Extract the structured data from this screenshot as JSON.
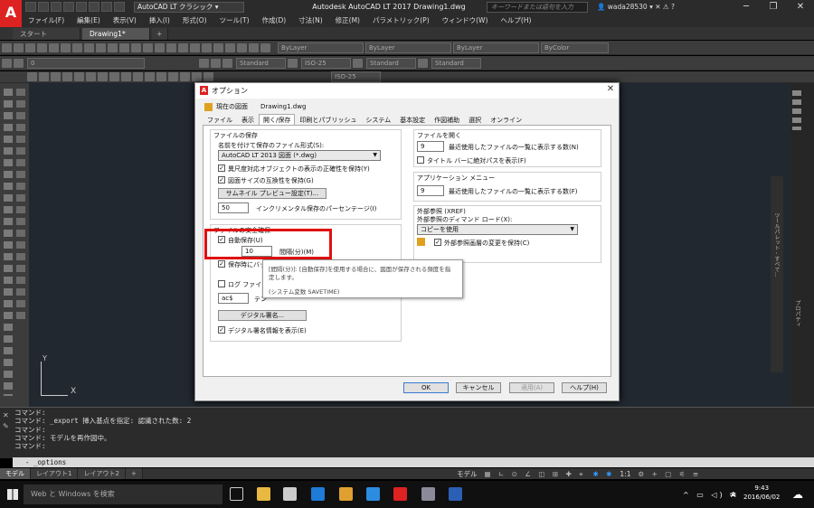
{
  "app": {
    "logo": "A",
    "logo_sub": "LT",
    "workspace": "AutoCAD LT クラシック",
    "title": "Autodesk AutoCAD LT 2017   Drawing1.dwg",
    "search_placeholder": "キーワードまたは語句を入力",
    "user": "wada28530",
    "win_min": "─",
    "win_max": "❐",
    "win_close": "✕"
  },
  "menu": [
    "ファイル(F)",
    "編集(E)",
    "表示(V)",
    "挿入(I)",
    "形式(O)",
    "ツール(T)",
    "作成(D)",
    "寸法(N)",
    "修正(M)",
    "パラメトリック(P)",
    "ウィンドウ(W)",
    "ヘルプ(H)"
  ],
  "doc_tabs": {
    "start": "スタート",
    "drawing": "Drawing1*",
    "add": "+"
  },
  "toolbar": {
    "layer": "ByLayer",
    "linetype": "ByLayer",
    "lineweight": "ByLayer",
    "color": "ByColor",
    "layer_current": "0",
    "text_style": "Standard",
    "dim_style": "ISO-25",
    "table_style": "Standard",
    "mleader_style": "Standard",
    "dim_style2": "ISO-25"
  },
  "dialog": {
    "title": "オプション",
    "current_drawing_label": "現在の図面",
    "current_drawing_value": "Drawing1.dwg",
    "tabs": [
      "ファイル",
      "表示",
      "開く/保存",
      "印刷とパブリッシュ",
      "システム",
      "基本設定",
      "作図補助",
      "選択",
      "オンライン"
    ],
    "active_tab": "開く/保存",
    "file_save": {
      "title": "ファイルの保存",
      "format_label": "名前を付けて保存のファイル形式(S):",
      "format_value": "AutoCAD LT 2013 図面 (*.dwg)",
      "opt1": "異尺度対応オブジェクトの表示の正確性を保持(Y)",
      "opt2": "図面サイズの互換性を保持(G)",
      "thumb_btn": "サムネイル プレビュー設定(T)...",
      "incr_value": "50",
      "incr_label": "インクリメンタル保存のパーセンテージ(I)"
    },
    "file_safety": {
      "title": "ファイルの安全確保",
      "autosave": "自動保存(U)",
      "interval_value": "10",
      "interval_label": "間隔(分)(M)",
      "backup": "保存時にバックアップ",
      "log": "ログ ファイルを",
      "ext_value": "ac$",
      "ext_label": "テン",
      "sig_btn": "デジタル署名...",
      "sig_show": "デジタル署名情報を表示(E)"
    },
    "file_open": {
      "title": "ファイルを開く",
      "recent_value": "9",
      "recent_label": "最近使用したファイルの一覧に表示する数(N)",
      "fullpath": "タイトル バーに絶対パスを表示(F)"
    },
    "app_menu": {
      "title": "アプリケーション メニュー",
      "recent_value": "9",
      "recent_label": "最近使用したファイルの一覧に表示する数(F)"
    },
    "xref": {
      "title": "外部参照 (XREF)",
      "demand_label": "外部参照のディマンド ロード(X):",
      "demand_value": "コピーを使用",
      "keep_layer": "外部参照画層の変更を保持(C)"
    },
    "tooltip": {
      "line1": "[間隔(分)]: [自動保存]を使用する場合に、図面が保存される頻度を指",
      "line2": "定します。",
      "line3": "(システム変数 SAVETIME)"
    },
    "ok": "OK",
    "cancel": "キャンセル",
    "apply": "適用(A)",
    "help": "ヘルプ(H)"
  },
  "command": {
    "lines": [
      "コマンド:",
      "コマンド: _export 挿入基点を指定: 認識された数: 2",
      "コマンド:",
      "コマンド: モデルを再作図中。",
      "コマンド:"
    ],
    "input": "- _options"
  },
  "layout_tabs": [
    "モデル",
    "レイアウト1",
    "レイアウト2",
    "+"
  ],
  "status": {
    "model": "モデル",
    "scale": "1:1"
  },
  "taskbar": {
    "search": "Web と Windows を検索",
    "ime": "A",
    "time": "9:43",
    "date": "2016/06/02"
  },
  "axis": {
    "y": "Y",
    "x": "X"
  },
  "side_panels": {
    "props": "プロパティ",
    "tool_palettes": "ツールパレット - すべて..."
  }
}
